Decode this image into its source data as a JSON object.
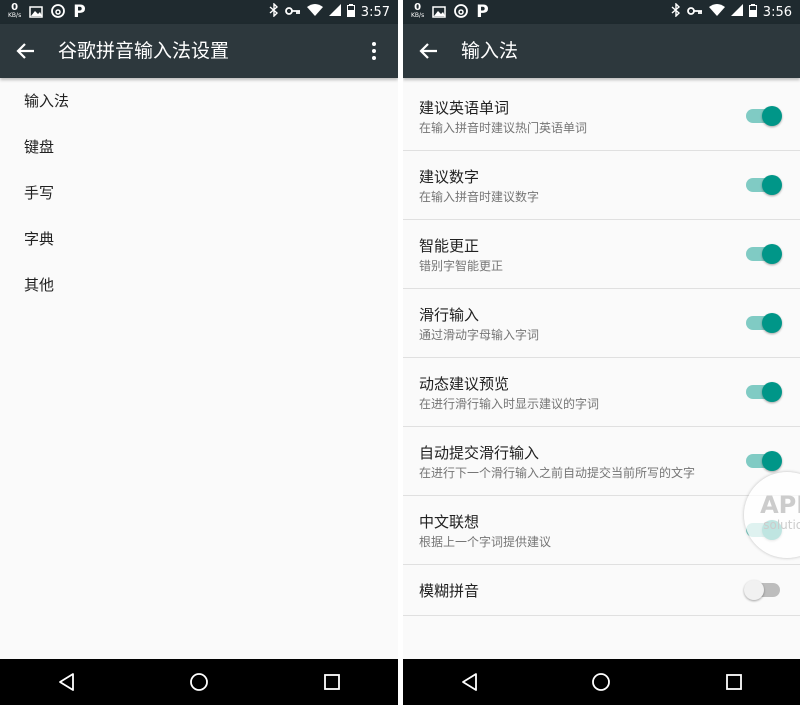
{
  "left_screen": {
    "status": {
      "speed_value": "0",
      "speed_unit": "KB/s",
      "p_label": "P",
      "time": "3:57"
    },
    "toolbar": {
      "title": "谷歌拼音输入法设置"
    },
    "menu": [
      "输入法",
      "键盘",
      "手写",
      "字典",
      "其他"
    ]
  },
  "right_screen": {
    "status": {
      "speed_value": "0",
      "speed_unit": "KB/s",
      "p_label": "P",
      "time": "3:56"
    },
    "toolbar": {
      "title": "输入法"
    },
    "settings": [
      {
        "title": "建议英语单词",
        "summary": "在输入拼音时建议热门英语单词",
        "enabled": true
      },
      {
        "title": "建议数字",
        "summary": "在输入拼音时建议数字",
        "enabled": true
      },
      {
        "title": "智能更正",
        "summary": "错别字智能更正",
        "enabled": true
      },
      {
        "title": "滑行输入",
        "summary": "通过滑动字母输入字词",
        "enabled": true
      },
      {
        "title": "动态建议预览",
        "summary": "在进行滑行输入时显示建议的字词",
        "enabled": true
      },
      {
        "title": "自动提交滑行输入",
        "summary": "在进行下一个滑行输入之前自动提交当前所写的文字",
        "enabled": true
      },
      {
        "title": "中文联想",
        "summary": "根据上一个字词提供建议",
        "enabled": true
      },
      {
        "title": "模糊拼音",
        "summary": "",
        "enabled": false
      }
    ],
    "watermark": {
      "line1": "APP",
      "line2": "solution"
    }
  },
  "colors": {
    "status_bar": "#1f2a2f",
    "toolbar": "#2d383d",
    "accent": "#009688",
    "accent_track": "#80cbc4"
  }
}
